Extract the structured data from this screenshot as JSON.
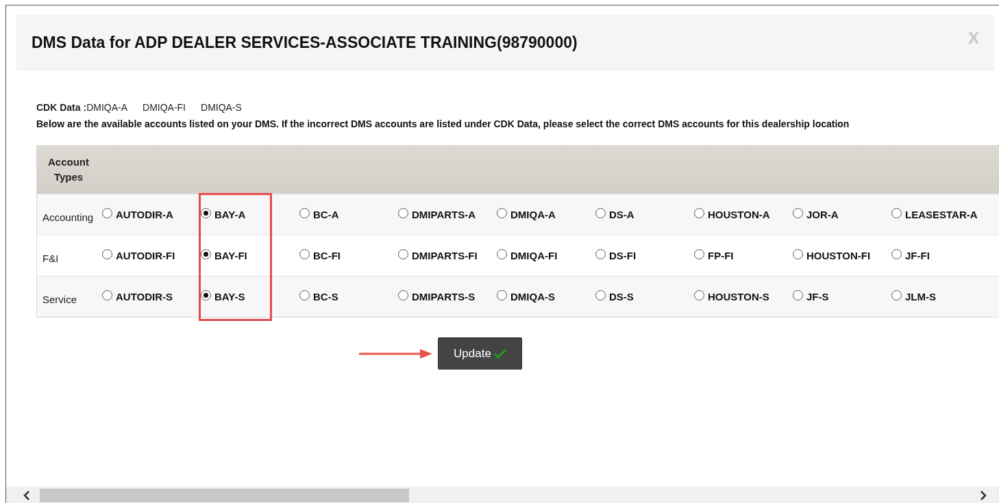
{
  "dialog": {
    "title": "DMS Data for ADP DEALER SERVICES-ASSOCIATE TRAINING(98790000)",
    "close": "X"
  },
  "cdk_data": {
    "label": "CDK Data :",
    "values": [
      "DMIQA-A",
      "DMIQA-FI",
      "DMIQA-S"
    ]
  },
  "instructions": "Below are the available accounts listed on your DMS. If the incorrect DMS accounts are listed under CDK Data, please select the correct DMS accounts for this dealership location",
  "table": {
    "header": "Account Types",
    "rows": [
      {
        "label": "Accounting",
        "options": [
          {
            "label": "AUTODIR-A",
            "selected": false
          },
          {
            "label": "BAY-A",
            "selected": true
          },
          {
            "label": "BC-A",
            "selected": false
          },
          {
            "label": "DMIPARTS-A",
            "selected": false
          },
          {
            "label": "DMIQA-A",
            "selected": false
          },
          {
            "label": "DS-A",
            "selected": false
          },
          {
            "label": "HOUSTON-A",
            "selected": false
          },
          {
            "label": "JOR-A",
            "selected": false
          },
          {
            "label": "LEASESTAR-A",
            "selected": false
          }
        ]
      },
      {
        "label": "F&I",
        "options": [
          {
            "label": "AUTODIR-FI",
            "selected": false
          },
          {
            "label": "BAY-FI",
            "selected": true
          },
          {
            "label": "BC-FI",
            "selected": false
          },
          {
            "label": "DMIPARTS-FI",
            "selected": false
          },
          {
            "label": "DMIQA-FI",
            "selected": false
          },
          {
            "label": "DS-FI",
            "selected": false
          },
          {
            "label": "FP-FI",
            "selected": false
          },
          {
            "label": "HOUSTON-FI",
            "selected": false
          },
          {
            "label": "JF-FI",
            "selected": false
          }
        ]
      },
      {
        "label": "Service",
        "options": [
          {
            "label": "AUTODIR-S",
            "selected": false
          },
          {
            "label": "BAY-S",
            "selected": true
          },
          {
            "label": "BC-S",
            "selected": false
          },
          {
            "label": "DMIPARTS-S",
            "selected": false
          },
          {
            "label": "DMIQA-S",
            "selected": false
          },
          {
            "label": "DS-S",
            "selected": false
          },
          {
            "label": "HOUSTON-S",
            "selected": false
          },
          {
            "label": "JF-S",
            "selected": false
          },
          {
            "label": "JLM-S",
            "selected": false
          }
        ]
      }
    ]
  },
  "update_button": {
    "label": "Update"
  }
}
